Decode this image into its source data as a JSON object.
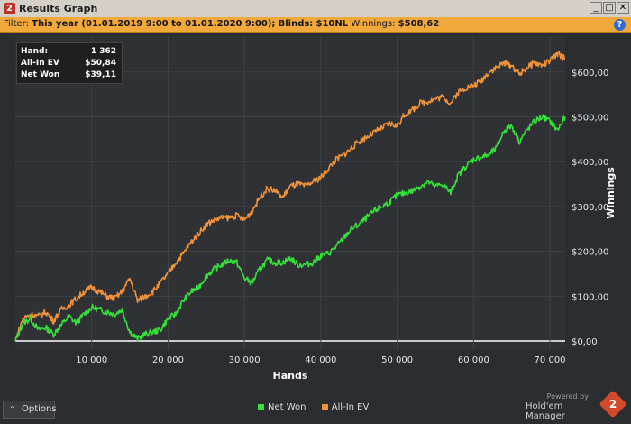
{
  "window": {
    "icon_text": "2",
    "title": "Results Graph",
    "minimize": "_",
    "maximize": "□",
    "close": "✕"
  },
  "filter": {
    "label": "Filter:",
    "period": "This year (01.01.2019 9:00 to 01.01.2020 9:00);",
    "blinds_label": "Blinds:",
    "blinds": "$10NL",
    "winnings_label": "Winnings:",
    "winnings": "$508,62",
    "help_icon": "?"
  },
  "summary": {
    "rows": [
      {
        "label": "Hand:",
        "value": "1 362"
      },
      {
        "label": "All-In EV",
        "value": "$50,84"
      },
      {
        "label": "Net Won",
        "value": "$39,11"
      }
    ]
  },
  "options": {
    "label": "Options",
    "caret": "⌃"
  },
  "powered": {
    "line1": "Powered by",
    "line2": "Hold'em Manager",
    "badge": "2"
  },
  "colors": {
    "net_won": "#35e03a",
    "all_in_ev": "#f0923a",
    "zero_line": "#ffffff",
    "grid": "#3f4245"
  },
  "chart_data": {
    "type": "line",
    "xlabel": "Hands",
    "ylabel": "Winnings",
    "xlim": [
      0,
      72000
    ],
    "ylim": [
      -20,
      680
    ],
    "x_ticks": [
      10000,
      20000,
      30000,
      40000,
      50000,
      60000,
      70000
    ],
    "x_tick_labels": [
      "10 000",
      "20 000",
      "30 000",
      "40 000",
      "50 000",
      "60 000",
      "70 000"
    ],
    "y_ticks": [
      0,
      100,
      200,
      300,
      400,
      500,
      600
    ],
    "y_tick_labels": [
      "$0,00",
      "$100,00",
      "$200,00",
      "$300,00",
      "$400,00",
      "$500,00",
      "$600,00"
    ],
    "y_axis_position": "right",
    "legend_position": "bottom",
    "grid": true,
    "series": [
      {
        "name": "Net Won",
        "color": "#35e03a",
        "x": [
          0,
          1000,
          2000,
          3000,
          4000,
          5000,
          6000,
          7000,
          8000,
          9000,
          10000,
          11000,
          12000,
          13000,
          14000,
          15000,
          16000,
          17000,
          18000,
          19000,
          20000,
          21000,
          22000,
          23000,
          24000,
          25000,
          26000,
          27000,
          28000,
          29000,
          30000,
          31000,
          32000,
          33000,
          34000,
          35000,
          36000,
          37000,
          38000,
          39000,
          40000,
          41000,
          42000,
          43000,
          44000,
          45000,
          46000,
          47000,
          48000,
          49000,
          50000,
          51000,
          52000,
          53000,
          54000,
          55000,
          56000,
          57000,
          58000,
          59000,
          60000,
          61000,
          62000,
          63000,
          64000,
          65000,
          66000,
          67000,
          68000,
          69000,
          70000,
          71000,
          72000
        ],
        "values": [
          0,
          40,
          50,
          25,
          30,
          15,
          35,
          55,
          40,
          60,
          75,
          70,
          65,
          60,
          70,
          20,
          5,
          15,
          20,
          25,
          50,
          60,
          90,
          110,
          120,
          145,
          160,
          170,
          180,
          175,
          140,
          130,
          160,
          180,
          175,
          175,
          185,
          170,
          170,
          175,
          190,
          195,
          210,
          230,
          250,
          260,
          275,
          290,
          300,
          310,
          325,
          330,
          335,
          345,
          355,
          345,
          350,
          330,
          370,
          390,
          405,
          410,
          415,
          430,
          470,
          480,
          445,
          470,
          490,
          500,
          490,
          470,
          500
        ]
      },
      {
        "name": "All-In EV",
        "color": "#f0923a",
        "x": [
          0,
          1000,
          2000,
          3000,
          4000,
          5000,
          6000,
          7000,
          8000,
          9000,
          10000,
          11000,
          12000,
          13000,
          14000,
          15000,
          16000,
          17000,
          18000,
          19000,
          20000,
          21000,
          22000,
          23000,
          24000,
          25000,
          26000,
          27000,
          28000,
          29000,
          30000,
          31000,
          32000,
          33000,
          34000,
          35000,
          36000,
          37000,
          38000,
          39000,
          40000,
          41000,
          42000,
          43000,
          44000,
          45000,
          46000,
          47000,
          48000,
          49000,
          50000,
          51000,
          52000,
          53000,
          54000,
          55000,
          56000,
          57000,
          58000,
          59000,
          60000,
          61000,
          62000,
          63000,
          64000,
          65000,
          66000,
          67000,
          68000,
          69000,
          70000,
          71000,
          72000
        ],
        "values": [
          0,
          50,
          60,
          55,
          65,
          45,
          70,
          80,
          95,
          110,
          120,
          110,
          100,
          95,
          110,
          140,
          90,
          100,
          110,
          130,
          150,
          175,
          195,
          220,
          240,
          260,
          270,
          275,
          275,
          280,
          270,
          290,
          320,
          340,
          335,
          320,
          345,
          350,
          345,
          355,
          365,
          385,
          405,
          415,
          430,
          445,
          455,
          465,
          475,
          485,
          480,
          505,
          515,
          530,
          535,
          540,
          545,
          530,
          555,
          565,
          570,
          580,
          600,
          610,
          620,
          615,
          595,
          610,
          620,
          615,
          625,
          640,
          630
        ]
      }
    ]
  }
}
